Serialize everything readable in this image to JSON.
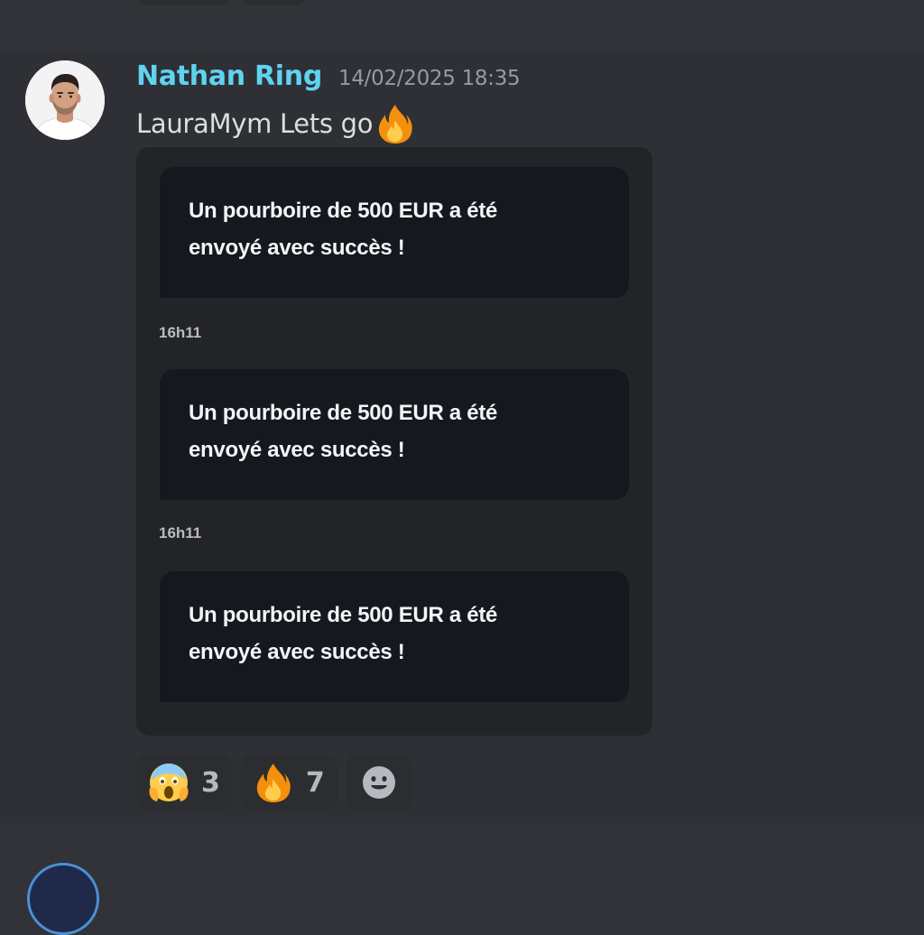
{
  "message": {
    "author": "Nathan Ring",
    "timestamp": "14/02/2025 18:35",
    "text": "LauraMym Lets go",
    "text_emoji_icon": "fire-emoji",
    "author_color": "#5fd3f0"
  },
  "attachment": {
    "bubbles": [
      {
        "line1": "Un pourboire de 500 EUR a été",
        "line2": "envoyé avec succès !"
      },
      {
        "line1": "Un pourboire de 500 EUR a été",
        "line2": "envoyé avec succès !"
      },
      {
        "line1": "Un pourboire de 500 EUR a été",
        "line2": "envoyé avec succès !"
      }
    ],
    "times": [
      "16h11",
      "16h11"
    ]
  },
  "reactions": [
    {
      "icon": "screaming-face-emoji",
      "count": "3"
    },
    {
      "icon": "fire-emoji",
      "count": "7"
    },
    {
      "icon": "add-reaction-smiley-icon"
    }
  ]
}
